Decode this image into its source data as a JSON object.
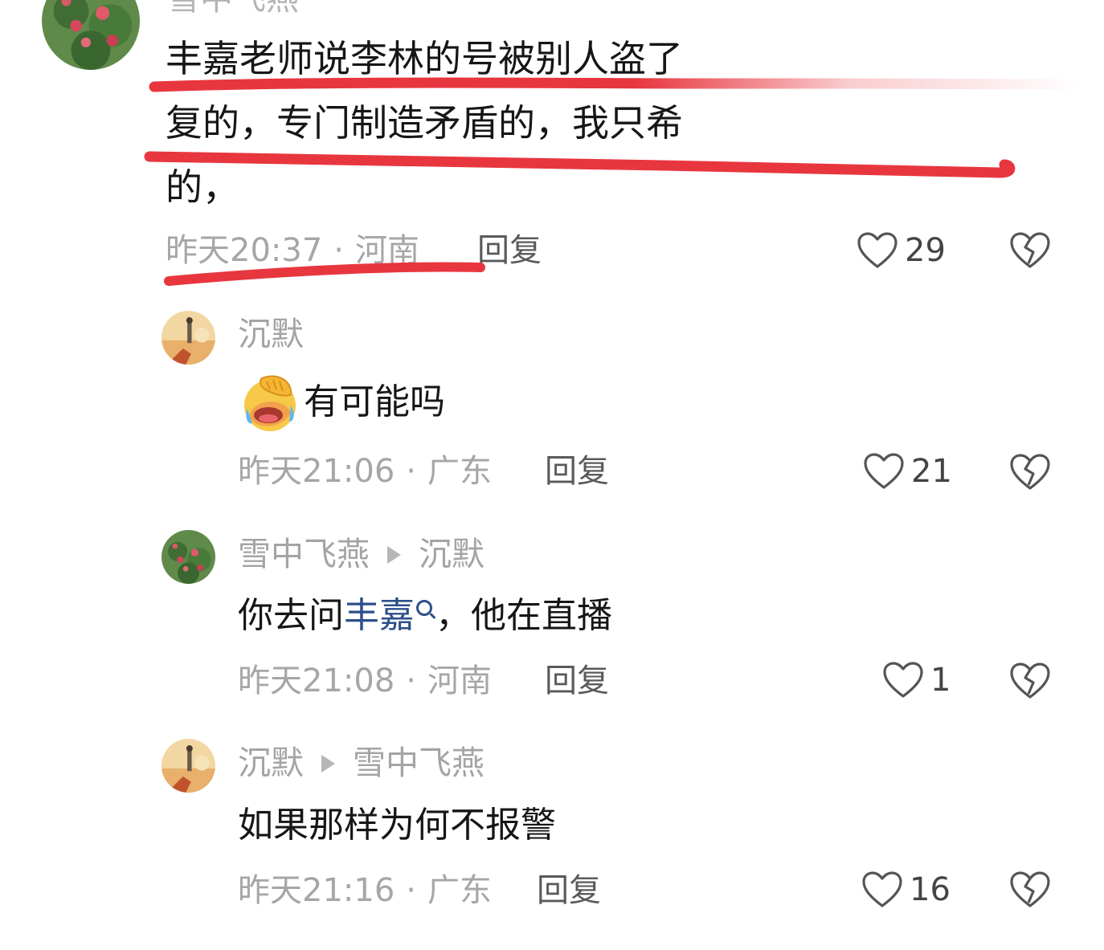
{
  "top_comment": {
    "username": "雪中飞燕",
    "lines": [
      "丰嘉老师说李林的号被别人盗了",
      "复的，专门制造矛盾的，我只希",
      "的，"
    ],
    "time": "昨天20:37",
    "location": "河南",
    "reply_label": "回复",
    "likes": "29"
  },
  "replies": [
    {
      "username": "沉默",
      "reply_to": "",
      "emoji": "face-palm-laughing-emoji",
      "text": "有可能吗",
      "time": "昨天21:06",
      "location": "广东",
      "reply_label": "回复",
      "likes": "21"
    },
    {
      "username": "雪中飞燕",
      "reply_to": "沉默",
      "text_before": "你去问",
      "mention": "丰嘉",
      "text_after": "，他在直播",
      "time": "昨天21:08",
      "location": "河南",
      "reply_label": "回复",
      "likes": "1"
    },
    {
      "username": "沉默",
      "reply_to": "雪中飞燕",
      "text": "如果那样为何不报警",
      "time": "昨天21:16",
      "location": "广东",
      "reply_label": "回复",
      "likes": "16"
    }
  ],
  "colors": {
    "annotation_red": "#e8363f",
    "mention_blue": "#2c4f8a",
    "meta_gray": "#a6a6a6"
  },
  "icons": [
    "heart-outline-icon",
    "broken-heart-icon",
    "search-icon"
  ]
}
